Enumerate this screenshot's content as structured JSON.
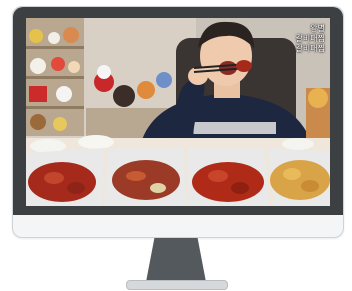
{
  "stream": {
    "overlay_lines": [
      "왕별",
      "갈비대찜",
      "갈비대찜"
    ]
  },
  "colors": {
    "bezel": "#3c4043",
    "frame": "#f4f5f6",
    "stand": "#54595d",
    "sauce": "#a52a1c",
    "tray": "#e9e9e9"
  },
  "icons": [
    "monitor-icon",
    "video-frame"
  ]
}
